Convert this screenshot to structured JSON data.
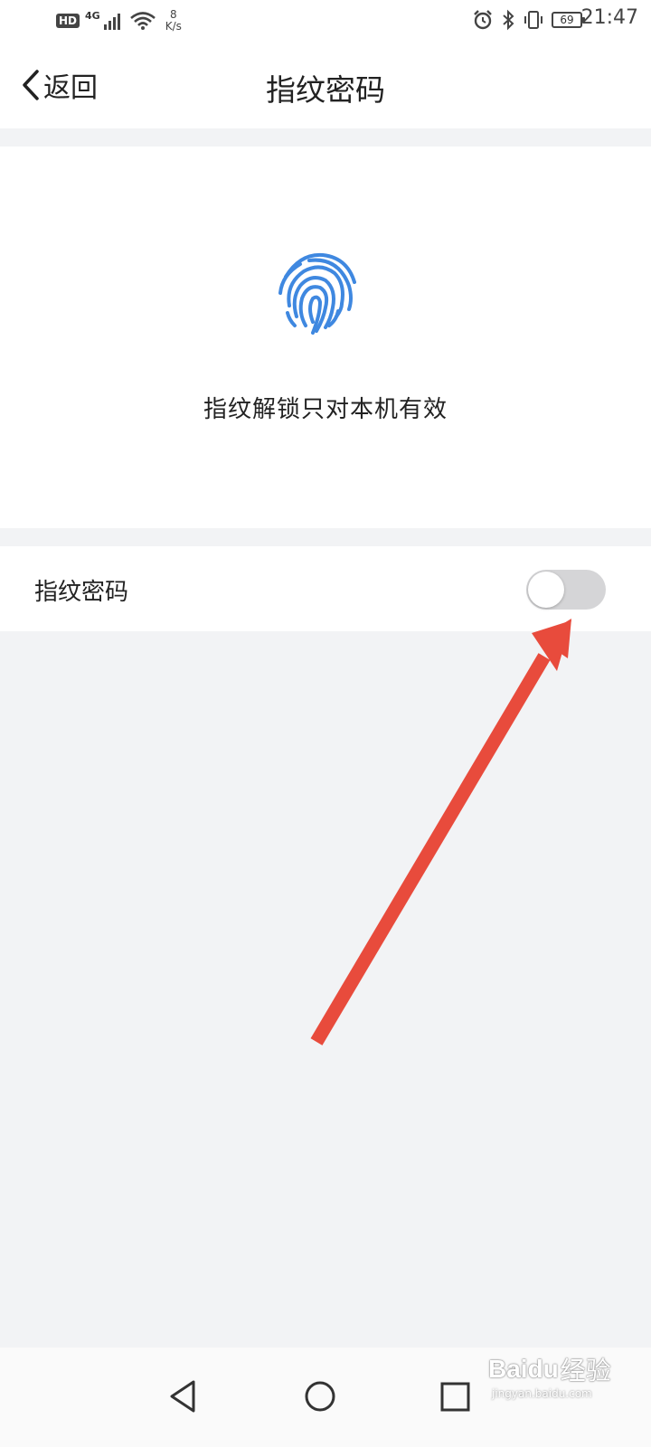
{
  "status_bar": {
    "hd": "HD",
    "network": "4G",
    "speed_value": "8",
    "speed_unit": "K/s",
    "battery_level": "69",
    "time": "21:47",
    "icons": [
      "signal-icon",
      "wifi-icon",
      "alarm-icon",
      "bluetooth-icon",
      "vibrate-icon",
      "battery-icon"
    ]
  },
  "header": {
    "back_label": "返回",
    "title": "指纹密码"
  },
  "hero": {
    "icon": "fingerprint-icon",
    "icon_color": "#3f88e0",
    "text": "指纹解锁只对本机有效"
  },
  "settings": {
    "fingerprint_label": "指纹密码",
    "fingerprint_enabled": false
  },
  "annotation": {
    "arrow_color": "#e84b3c"
  },
  "nav_bar": {
    "buttons": [
      "back-triangle-icon",
      "home-circle-icon",
      "recents-square-icon"
    ]
  },
  "watermark": {
    "brand": "Baidu",
    "suffix": "经验",
    "sub": "jingyan.baidu.com"
  }
}
